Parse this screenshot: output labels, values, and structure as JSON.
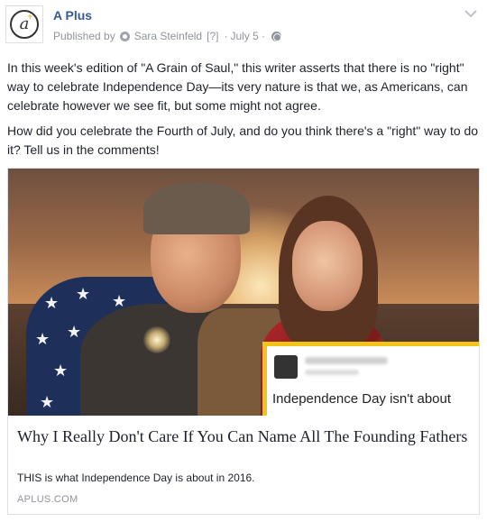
{
  "post": {
    "page_name": "A Plus",
    "published_by_label": "Published by",
    "author": "Sara Steinfeld",
    "author_note": "[?]",
    "date": "July 5",
    "icons": {
      "avatar": "a-plus-logo",
      "author_dot": "profile-dot-icon",
      "privacy": "globe-icon",
      "menu": "chevron-down-icon"
    },
    "paragraphs": [
      "In this week's edition of \"A Grain of Saul,\" this writer asserts that there is no \"right\" way to celebrate Independence Day—its very nature is that we, as Americans, can celebrate however we see fit, but some might not agree.",
      "How did you celebrate the Fourth of July, and do you think there's a \"right\" way to do it? Tell us in the comments!"
    ]
  },
  "link_card": {
    "image_overlay_text": "Independence Day isn't about",
    "title": "Why I Really Don't Care If You Can Name All The Founding Fathers",
    "description": "THIS is what Independence Day is about in 2016.",
    "domain": "APLUS.COM",
    "accent_color": "#f2c417"
  },
  "colors": {
    "link_blue": "#365899",
    "meta_gray": "#90949c",
    "text": "#1d2129"
  }
}
